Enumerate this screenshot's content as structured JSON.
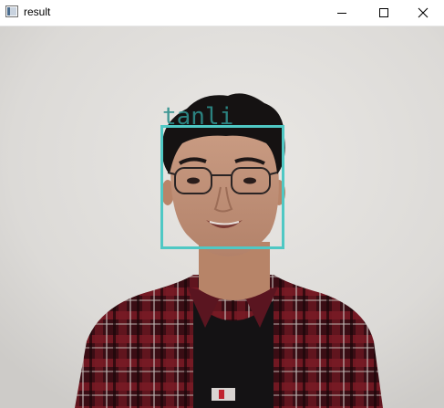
{
  "window": {
    "title": "result",
    "icon": "opencv-window-icon",
    "controls": [
      "minimize-icon",
      "maximize-icon",
      "close-icon"
    ]
  },
  "image": {
    "description_icon": "webcam-frame",
    "detection": {
      "label": "tanli",
      "box_color": "#4fc8c4",
      "label_color": "#2e8f8c"
    }
  }
}
